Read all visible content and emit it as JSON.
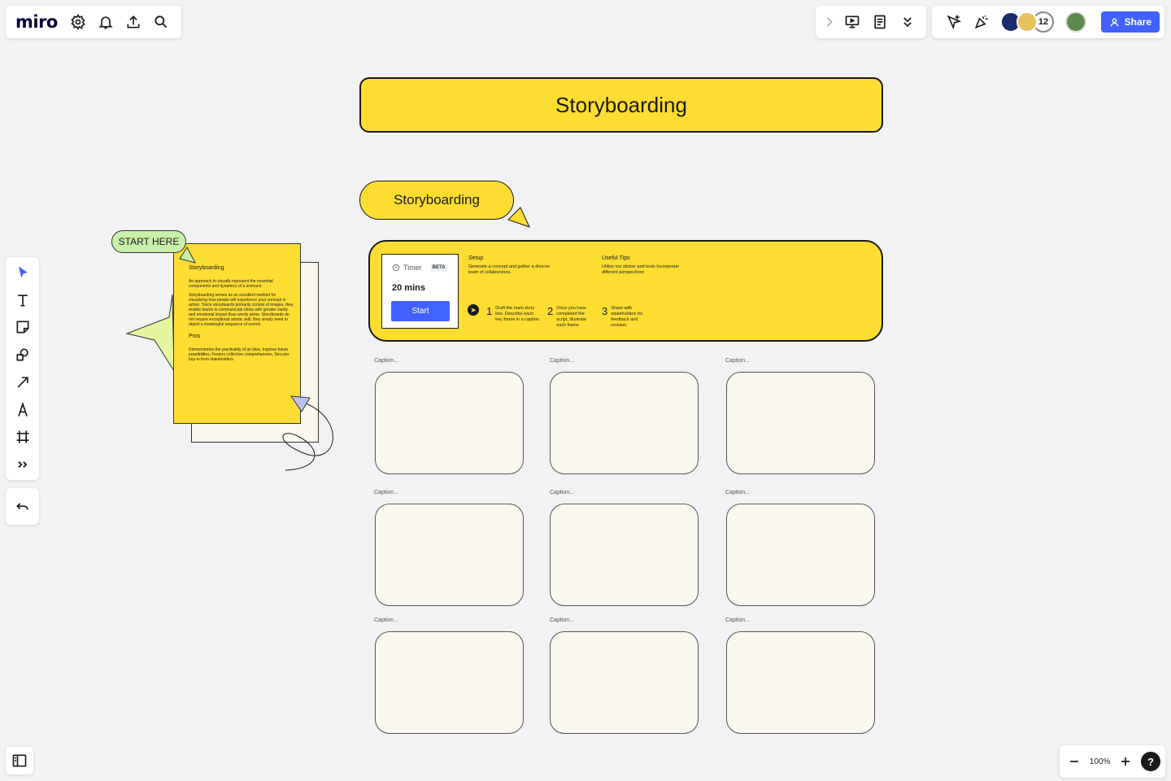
{
  "app": {
    "logo": "miro"
  },
  "topbar": {
    "share_label": "Share",
    "collaborator_count": "12"
  },
  "board": {
    "title": "Storyboarding",
    "subtitle": "Storyboarding",
    "start_here": "START HERE"
  },
  "timer": {
    "label": "Timer",
    "badge": "BETA",
    "value": "20 mins",
    "start_label": "Start"
  },
  "setup": {
    "title": "Setup",
    "text": "Generate a concept and gather a diverse team of collaborators."
  },
  "tips": {
    "title": "Useful Tips",
    "text": "Utilize our sticker and tools Incorporate different perspectives"
  },
  "steps": [
    {
      "num": "1",
      "text": "Draft the main story line. Describe each key frame in a caption."
    },
    {
      "num": "2",
      "text": "Once you have completed the script, illustrate each frame."
    },
    {
      "num": "3",
      "text": "Share with stakeholders for feedback and revision."
    }
  ],
  "captions": [
    "Caption...",
    "Caption...",
    "Caption...",
    "Caption...",
    "Caption...",
    "Caption...",
    "Caption...",
    "Caption...",
    "Caption..."
  ],
  "note": {
    "title": "Storyboarding",
    "intro": "An approach to visually represent the essential components and dynamics of a scenario",
    "body": "Storyboarding serves as an excellent method for visualizing how people will experience your concept in action. Since storyboards primarily consist of images, they enable teams to communicate ideas with greater clarity and emotional impact than words alone. Storyboards do not require exceptional artistic skill, they simply need to depict a meaningful sequence of events.",
    "pros_title": "Pros",
    "pros_text": "Demonstrates the practicality of an idea, Inspires future possibilities, Fosters collective comprehension, Secures buy-in from stakeholders."
  },
  "zoom": {
    "value": "100%"
  },
  "help_label": "?",
  "colors": {
    "accent": "#4262ff",
    "yellow": "#fedd33",
    "green_tag": "#c8f0a8",
    "frame_bg": "#faf8ee"
  }
}
